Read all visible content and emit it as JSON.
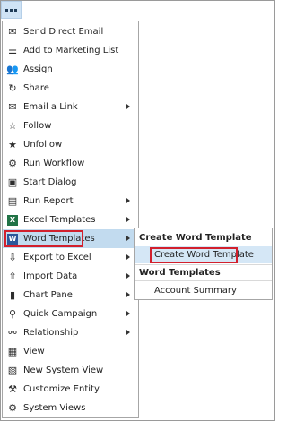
{
  "menu": {
    "items": [
      {
        "label": "Send Direct Email",
        "icon": "envelope-icon",
        "glyph": "✉",
        "submenu": false
      },
      {
        "label": "Add to Marketing List",
        "icon": "list-icon",
        "glyph": "☰",
        "submenu": false
      },
      {
        "label": "Assign",
        "icon": "people-icon",
        "glyph": "👥",
        "submenu": false
      },
      {
        "label": "Share",
        "icon": "share-icon",
        "glyph": "↻",
        "submenu": false
      },
      {
        "label": "Email a Link",
        "icon": "link-icon",
        "glyph": "✉",
        "submenu": true
      },
      {
        "label": "Follow",
        "icon": "star-outline-icon",
        "glyph": "☆",
        "submenu": false
      },
      {
        "label": "Unfollow",
        "icon": "star-filled-icon",
        "glyph": "★",
        "submenu": false
      },
      {
        "label": "Run Workflow",
        "icon": "workflow-icon",
        "glyph": "⚙",
        "submenu": false
      },
      {
        "label": "Start Dialog",
        "icon": "dialog-icon",
        "glyph": "▣",
        "submenu": false
      },
      {
        "label": "Run Report",
        "icon": "report-icon",
        "glyph": "▤",
        "submenu": true
      },
      {
        "label": "Excel Templates",
        "icon": "excel-icon",
        "glyph": "X",
        "submenu": true
      },
      {
        "label": "Word Templates",
        "icon": "word-icon",
        "glyph": "W",
        "submenu": true
      },
      {
        "label": "Export to Excel",
        "icon": "export-excel-icon",
        "glyph": "⇩",
        "submenu": true
      },
      {
        "label": "Import Data",
        "icon": "import-icon",
        "glyph": "⇧",
        "submenu": true
      },
      {
        "label": "Chart Pane",
        "icon": "chart-icon",
        "glyph": "▮",
        "submenu": true
      },
      {
        "label": "Quick Campaign",
        "icon": "campaign-icon",
        "glyph": "⚲",
        "submenu": true
      },
      {
        "label": "Relationship",
        "icon": "relationship-icon",
        "glyph": "⚯",
        "submenu": true
      },
      {
        "label": "View",
        "icon": "view-icon",
        "glyph": "▦",
        "submenu": false
      },
      {
        "label": "New System View",
        "icon": "new-view-icon",
        "glyph": "▧",
        "submenu": false
      },
      {
        "label": "Customize Entity",
        "icon": "customize-icon",
        "glyph": "⚒",
        "submenu": false
      },
      {
        "label": "System Views",
        "icon": "system-views-icon",
        "glyph": "⚙",
        "submenu": false
      }
    ]
  },
  "submenu": {
    "header_create": "Create Word Template",
    "create_item": "Create Word Template",
    "header_templates": "Word Templates",
    "template_item": "Account Summary"
  },
  "colors": {
    "active_bg": "#c2dbef",
    "highlight_border": "#d2202d",
    "word_blue": "#2b579a",
    "excel_green": "#217346"
  }
}
